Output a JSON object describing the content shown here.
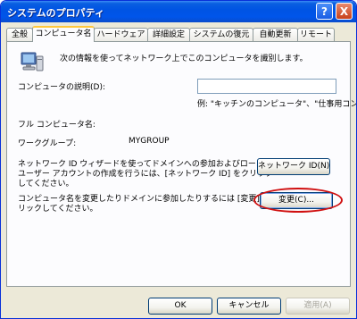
{
  "window": {
    "title": "システムのプロパティ",
    "help_button": "?",
    "close_button": "X"
  },
  "tabs": [
    {
      "label": "全般"
    },
    {
      "label": "コンピュータ名"
    },
    {
      "label": "ハードウェア"
    },
    {
      "label": "詳細設定"
    },
    {
      "label": "システムの復元"
    },
    {
      "label": "自動更新"
    },
    {
      "label": "リモート"
    }
  ],
  "computer_name_tab": {
    "intro_text": "次の情報を使ってネットワーク上でこのコンピュータを識別します。",
    "description_label": "コンピュータの説明(D):",
    "description_value": "",
    "example_text": "例: \"キッチンのコンピュータ\"、\"仕事用コンピュータ\"",
    "full_name_label": "フル コンピュータ名:",
    "full_name_value": "",
    "workgroup_label": "ワークグループ:",
    "workgroup_value": "MYGROUP",
    "network_id_text_1": "ネットワーク ID ウィザードを使ってドメインへの参加およびローカル",
    "network_id_text_2": "ユーザー アカウントの作成を行うには、[ネットワーク ID] をクリック",
    "network_id_text_3": "してください。",
    "network_id_button": "ネットワーク ID(N)",
    "change_text_1": "コンピュータ名を変更したりドメインに参加したりするには [変更] をク",
    "change_text_2": "リックしてください。",
    "change_button": "変更(C)..."
  },
  "footer": {
    "ok_button": "OK",
    "cancel_button": "キャンセル",
    "apply_button": "適用(A)"
  },
  "colors": {
    "titlebar": "#0054e3",
    "highlight_ring": "#d01010",
    "active_tab_accent": "#ffc73c"
  }
}
